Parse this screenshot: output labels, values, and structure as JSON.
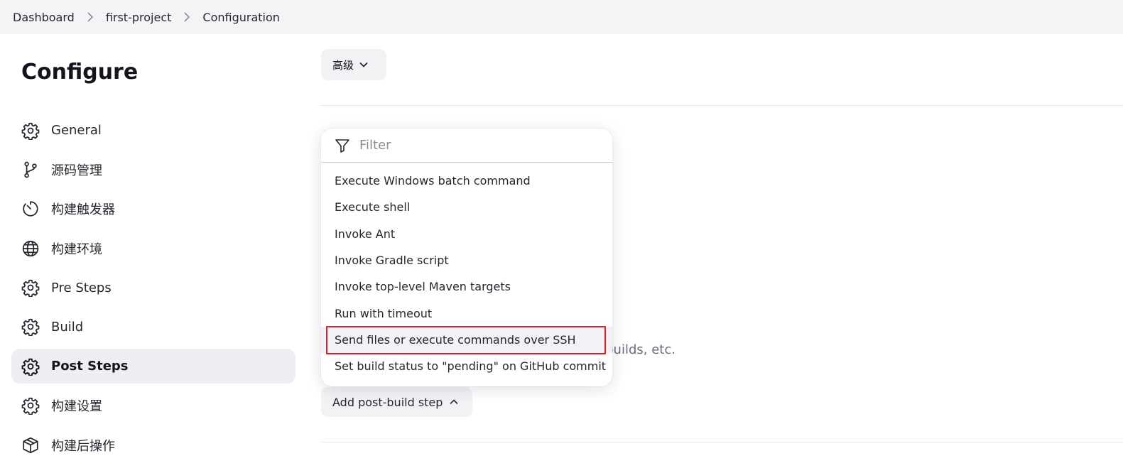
{
  "breadcrumb": {
    "items": [
      "Dashboard",
      "first-project",
      "Configuration"
    ],
    "separator": ">"
  },
  "page": {
    "title": "Configure"
  },
  "sidebar": {
    "items": [
      {
        "label": "General",
        "icon": "gear-icon",
        "active": false
      },
      {
        "label": "源码管理",
        "icon": "branch-icon",
        "active": false
      },
      {
        "label": "构建触发器",
        "icon": "timer-icon",
        "active": false
      },
      {
        "label": "构建环境",
        "icon": "globe-icon",
        "active": false
      },
      {
        "label": "Pre Steps",
        "icon": "gear-icon",
        "active": false
      },
      {
        "label": "Build",
        "icon": "gear-icon",
        "active": false
      },
      {
        "label": "Post Steps",
        "icon": "gear-icon",
        "active": true
      },
      {
        "label": "构建设置",
        "icon": "gear-icon",
        "active": false
      },
      {
        "label": "构建后操作",
        "icon": "package-icon",
        "active": false
      }
    ]
  },
  "main": {
    "advanced_button": "高级",
    "background_text": "ul builds, etc.",
    "add_step_button": "Add post-build step"
  },
  "dropdown": {
    "filter_placeholder": "Filter",
    "items": [
      "Execute Windows batch command",
      "Execute shell",
      "Invoke Ant",
      "Invoke Gradle script",
      "Invoke top-level Maven targets",
      "Run with timeout",
      "Send files or execute commands over SSH",
      "Set build status to \"pending\" on GitHub commit"
    ],
    "highlighted_index": 6
  },
  "colors": {
    "highlight_border": "#d8202c",
    "active_bg": "#ededf2",
    "breadcrumb_bg": "#f4f4f7"
  }
}
